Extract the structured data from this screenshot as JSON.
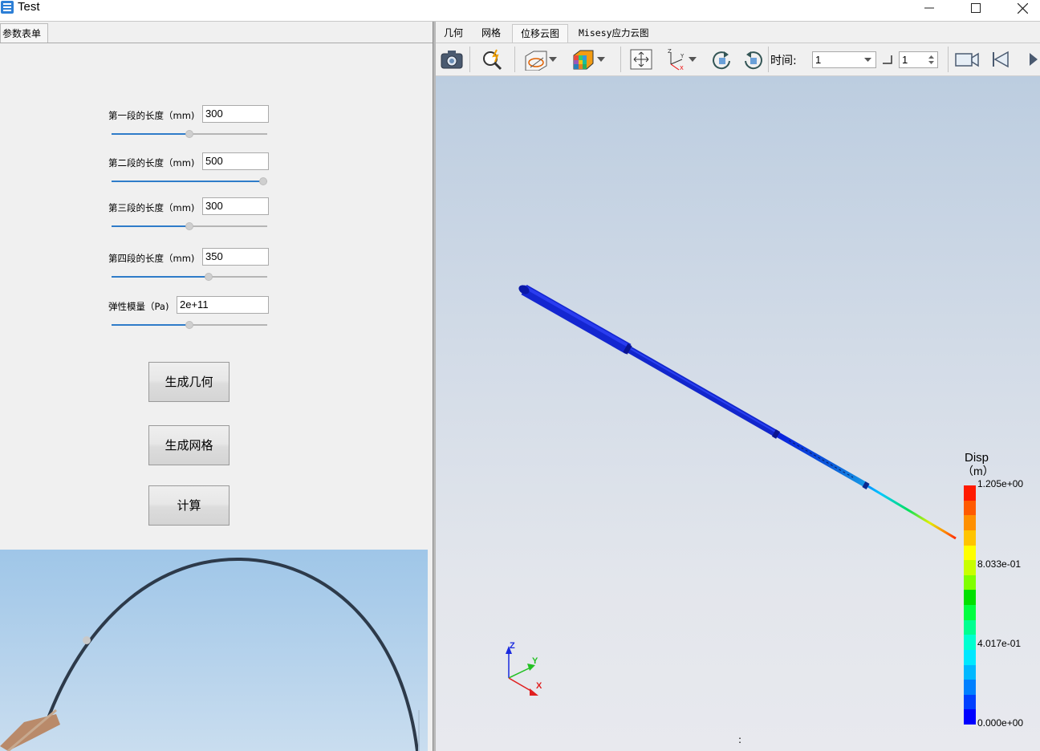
{
  "window": {
    "title": "Test"
  },
  "left_panel": {
    "tab_label": "参数表单",
    "params": [
      {
        "label": "第一段的长度（mm)",
        "value": "300",
        "slider_fraction": 0.5
      },
      {
        "label": "第二段的长度（mm)",
        "value": "500",
        "slider_fraction": 1.0
      },
      {
        "label": "第三段的长度（mm)",
        "value": "300",
        "slider_fraction": 0.5
      },
      {
        "label": "第四段的长度（mm)",
        "value": "350",
        "slider_fraction": 0.63
      },
      {
        "label": "弹性模量（Pa)",
        "value": "2e+11",
        "slider_fraction": 0.5
      }
    ],
    "buttons": {
      "generate_geometry": "生成几何",
      "generate_mesh": "生成网格",
      "compute": "计算"
    }
  },
  "right_panel": {
    "tabs": [
      "几何",
      "网格",
      "位移云图",
      "Misesy应力云图"
    ],
    "active_tab_index": 2,
    "toolbar": {
      "time_label": "时间:",
      "time_value": "1",
      "step_value": "1"
    },
    "legend": {
      "title_line1": "Disp",
      "title_line2": "（m）",
      "labels": [
        "1.205e+00",
        "8.033e-01",
        "4.017e-01",
        "0.000e+00"
      ],
      "colors": [
        "#ff1a00",
        "#ff5a00",
        "#ff9000",
        "#ffc400",
        "#ffff00",
        "#c8ff00",
        "#80ff00",
        "#00e000",
        "#00ff40",
        "#00ff90",
        "#00ffd0",
        "#00e8ff",
        "#00b8ff",
        "#0080ff",
        "#0040ff",
        "#0000ff"
      ]
    },
    "axes": {
      "x": "X",
      "y": "Y",
      "z": "Z"
    },
    "status_mark": ":"
  }
}
